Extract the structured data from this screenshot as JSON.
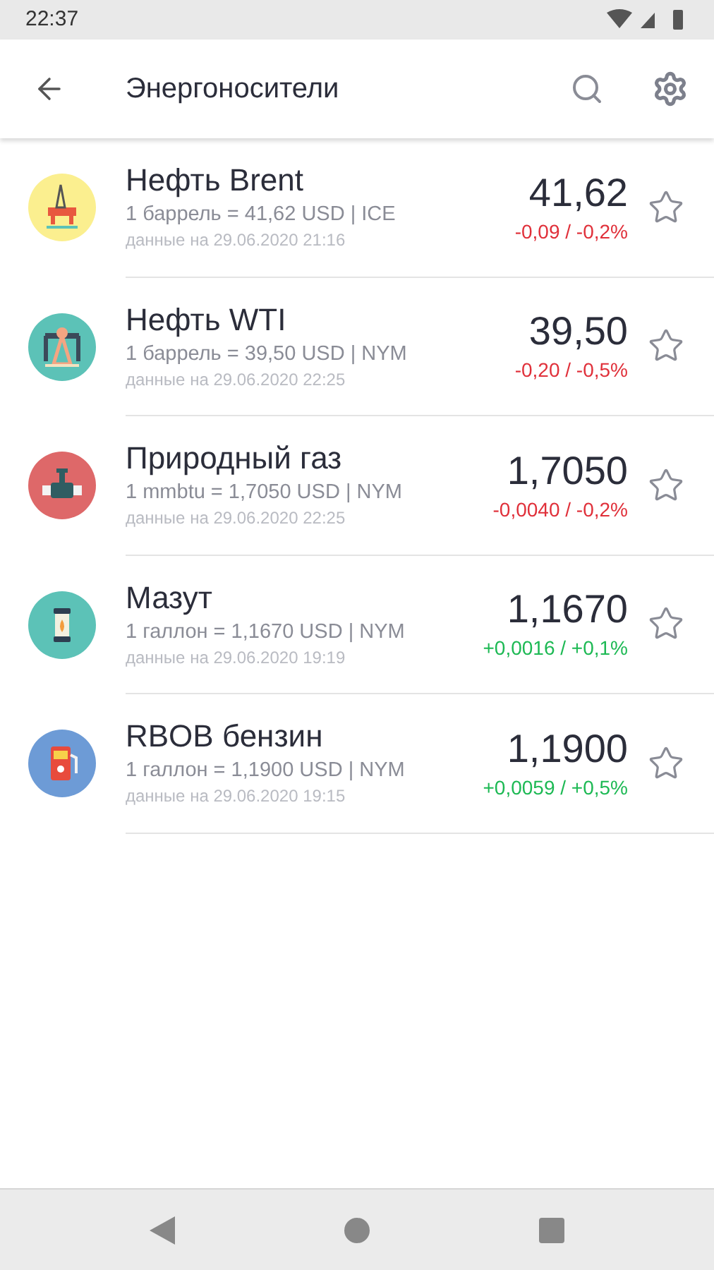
{
  "status_bar": {
    "time": "22:37"
  },
  "app_bar": {
    "title": "Энергоносители"
  },
  "items": [
    {
      "kind": "rig",
      "name": "Нефть Brent",
      "unit": "1 баррель = 41,62 USD | ICE",
      "date": "данные на 29.06.2020 21:16",
      "price": "41,62",
      "change": "-0,09 / -0,2%",
      "rising": false,
      "favorite": false
    },
    {
      "kind": "pumpjack",
      "name": "Нефть WTI",
      "unit": "1 баррель = 39,50 USD | NYM",
      "date": "данные на 29.06.2020 22:25",
      "price": "39,50",
      "change": "-0,20 / -0,5%",
      "rising": false,
      "favorite": false
    },
    {
      "kind": "pipe",
      "name": "Природный газ",
      "unit": "1 mmbtu = 1,7050 USD | NYM",
      "date": "данные на 29.06.2020 22:25",
      "price": "1,7050",
      "change": "-0,0040 / -0,2%",
      "rising": false,
      "favorite": false
    },
    {
      "kind": "lantern",
      "name": "Мазут",
      "unit": "1 галлон = 1,1670 USD | NYM",
      "date": "данные на 29.06.2020 19:19",
      "price": "1,1670",
      "change": "+0,0016 / +0,1%",
      "rising": true,
      "favorite": false
    },
    {
      "kind": "pump",
      "name": "RBOB бензин",
      "unit": "1 галлон = 1,1900 USD | NYM",
      "date": "данные на 29.06.2020 19:15",
      "price": "1,1900",
      "change": "+0,0059 / +0,5%",
      "rising": true,
      "favorite": false
    }
  ]
}
